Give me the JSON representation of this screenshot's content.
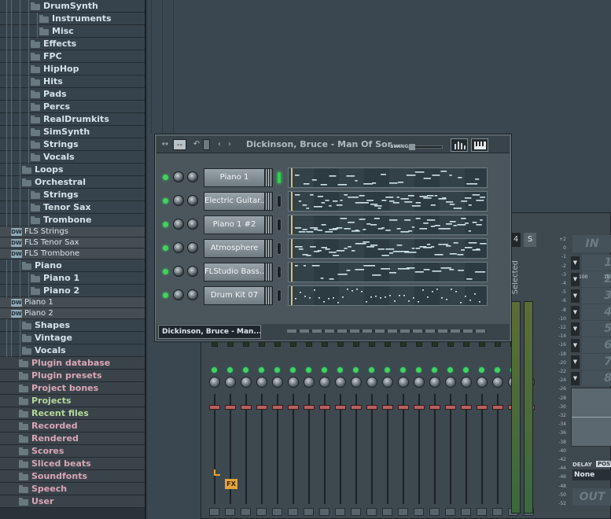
{
  "browser": {
    "items": [
      {
        "label": "DrumSynth",
        "kind": "folder",
        "depth": 3,
        "expanded": true
      },
      {
        "label": "Instruments",
        "kind": "folder",
        "depth": 4
      },
      {
        "label": "Misc",
        "kind": "folder",
        "depth": 4
      },
      {
        "label": "Effects",
        "kind": "folder",
        "depth": 3
      },
      {
        "label": "FPC",
        "kind": "folder",
        "depth": 3
      },
      {
        "label": "HipHop",
        "kind": "folder",
        "depth": 3
      },
      {
        "label": "Hits",
        "kind": "folder",
        "depth": 3
      },
      {
        "label": "Pads",
        "kind": "folder",
        "depth": 3
      },
      {
        "label": "Percs",
        "kind": "folder",
        "depth": 3
      },
      {
        "label": "RealDrumkits",
        "kind": "folder",
        "depth": 3
      },
      {
        "label": "SimSynth",
        "kind": "folder",
        "depth": 3
      },
      {
        "label": "Strings",
        "kind": "folder",
        "depth": 3
      },
      {
        "label": "Vocals",
        "kind": "folder",
        "depth": 3
      },
      {
        "label": "Loops",
        "kind": "folder",
        "depth": 2
      },
      {
        "label": "Orchestral",
        "kind": "folder",
        "depth": 2,
        "expanded": true
      },
      {
        "label": "Strings",
        "kind": "folder",
        "depth": 3
      },
      {
        "label": "Tenor Sax",
        "kind": "folder",
        "depth": 3
      },
      {
        "label": "Trombone",
        "kind": "folder",
        "depth": 3
      },
      {
        "label": "FLS Strings",
        "kind": "file"
      },
      {
        "label": "FLS Tenor Sax",
        "kind": "file"
      },
      {
        "label": "FLS Trombone",
        "kind": "file"
      },
      {
        "label": "Piano",
        "kind": "folder",
        "depth": 2,
        "expanded": true
      },
      {
        "label": "Piano 1",
        "kind": "folder",
        "depth": 3
      },
      {
        "label": "Piano 2",
        "kind": "folder",
        "depth": 3
      },
      {
        "label": "Piano 1",
        "kind": "file"
      },
      {
        "label": "Piano 2",
        "kind": "file"
      },
      {
        "label": "Shapes",
        "kind": "folder",
        "depth": 2
      },
      {
        "label": "Vintage",
        "kind": "folder",
        "depth": 2
      },
      {
        "label": "Vocals",
        "kind": "folder",
        "depth": 2
      },
      {
        "label": "Plugin database",
        "kind": "section",
        "color": "pink"
      },
      {
        "label": "Plugin presets",
        "kind": "section",
        "color": "pink"
      },
      {
        "label": "Project bones",
        "kind": "section",
        "color": "pink"
      },
      {
        "label": "Projects",
        "kind": "section",
        "color": "green"
      },
      {
        "label": "Recent files",
        "kind": "section",
        "color": "green"
      },
      {
        "label": "Recorded",
        "kind": "section",
        "color": "pink"
      },
      {
        "label": "Rendered",
        "kind": "section",
        "color": "pink"
      },
      {
        "label": "Scores",
        "kind": "section",
        "color": "pink"
      },
      {
        "label": "Sliced beats",
        "kind": "section",
        "color": "blue"
      },
      {
        "label": "Soundfonts",
        "kind": "section",
        "color": "blue"
      },
      {
        "label": "Speech",
        "kind": "section",
        "color": "blue"
      },
      {
        "label": "User",
        "kind": "section",
        "color": "blue"
      }
    ]
  },
  "channel_window": {
    "title": "Dickinson, Bruce - Man Of Sor...",
    "swing_label": "SWING",
    "bottom_tab": "Dickinson, Bruce - Man...",
    "channels": [
      {
        "name": "Piano 1",
        "selected": true
      },
      {
        "name": "Electric Guitar...",
        "selected": false
      },
      {
        "name": "Piano 1 #2",
        "selected": false
      },
      {
        "name": "Atmosphere",
        "selected": false
      },
      {
        "name": "FLStudio Bass...",
        "selected": false
      },
      {
        "name": "Drum Kit 07",
        "selected": false
      }
    ]
  },
  "mixer": {
    "selected_label": "Selected",
    "track_number": "4",
    "s_button": "S",
    "fx_tag": "FX",
    "in_label": "IN",
    "out_label": "OUT",
    "insert_slots": [
      "1",
      "2",
      "3",
      "4",
      "5",
      "6",
      "7",
      "8"
    ],
    "db_scale": [
      "+2",
      "0",
      "-1",
      "-2",
      "-3",
      "-4",
      "-5",
      "-6",
      "-8",
      "-10",
      "-12",
      "-14",
      "-16",
      "-18",
      "-20",
      "-22",
      "-24",
      "-26",
      "-28",
      "-30",
      "-32",
      "-34",
      "-36",
      "-38",
      "-40",
      "-42",
      "-44",
      "-46",
      "-48",
      "-50",
      "-52"
    ],
    "eq_ticks": [
      "100",
      "1k"
    ],
    "delay_label": "DELAY",
    "post_label": "POST",
    "delay_value": "None"
  },
  "colors": {
    "led_green": "#3fd45a",
    "fader_red": "#b76060",
    "fx_orange": "#e3a43a",
    "section_pink": "#d9a7b7"
  }
}
